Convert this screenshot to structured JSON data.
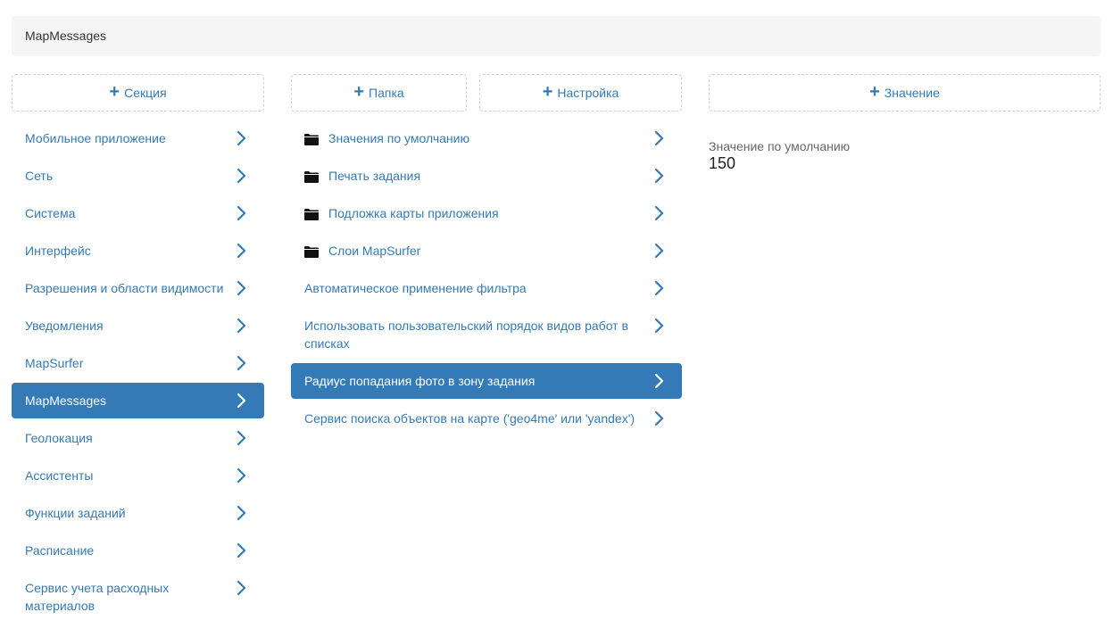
{
  "breadcrumb": {
    "text": "MapMessages"
  },
  "sections": {
    "add_label": "Секция",
    "items": [
      {
        "label": "Мобильное приложение"
      },
      {
        "label": "Сеть"
      },
      {
        "label": "Система"
      },
      {
        "label": "Интерфейс"
      },
      {
        "label": "Разрешения и области видимости"
      },
      {
        "label": "Уведомления"
      },
      {
        "label": "MapSurfer"
      },
      {
        "label": "MapMessages",
        "active": true
      },
      {
        "label": "Геолокация"
      },
      {
        "label": "Ассистенты"
      },
      {
        "label": "Функции заданий"
      },
      {
        "label": "Расписание"
      },
      {
        "label": "Сервис учета расходных материалов"
      }
    ]
  },
  "settings": {
    "add_folder_label": "Папка",
    "add_setting_label": "Настройка",
    "items": [
      {
        "label": "Значения по умолчанию",
        "icon": "folder-icon"
      },
      {
        "label": "Печать задания",
        "icon": "folder-icon"
      },
      {
        "label": "Подложка карты приложения",
        "icon": "folder-icon"
      },
      {
        "label": "Слои MapSurfer",
        "icon": "folder-icon"
      },
      {
        "label": "Автоматическое применение фильтра"
      },
      {
        "label": "Использовать пользовательский порядок видов работ в списках"
      },
      {
        "label": "Радиус попадания фото в зону задания",
        "active": true
      },
      {
        "label": "Сервис поиска объектов на карте ('geo4me' или 'yandex')"
      }
    ]
  },
  "values": {
    "add_label": "Значение",
    "label": "Значение по умолчанию",
    "value": "150"
  },
  "colors": {
    "accent": "#337ab7",
    "breadcrumb_bg": "#f5f5f5"
  }
}
